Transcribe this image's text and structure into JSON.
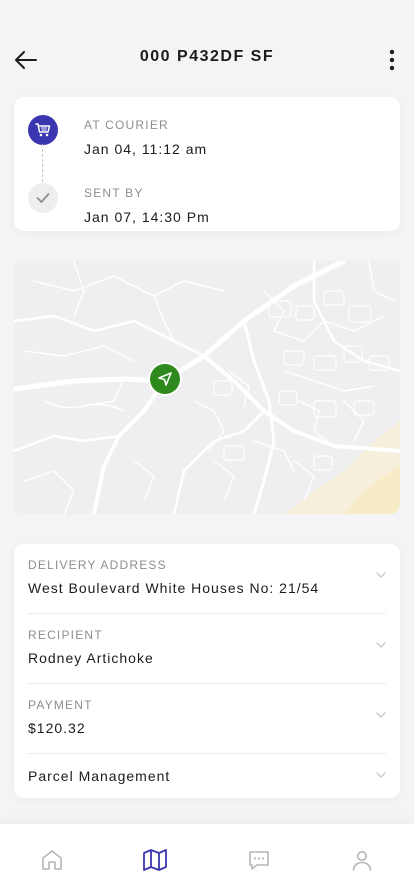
{
  "header": {
    "title": "000 P432DF SF"
  },
  "timeline": [
    {
      "label": "AT COURIER",
      "value": "Jan 04, 11:12 am",
      "icon": "cart-icon",
      "status": "active"
    },
    {
      "label": "SENT BY",
      "value": "Jan 07, 14:30 Pm",
      "icon": "check-icon",
      "status": "done"
    }
  ],
  "map": {
    "pin_icon": "navigation-arrow-icon"
  },
  "details": [
    {
      "label": "DELIVERY ADDRESS",
      "value": "West Boulevard White Houses No: 21/54"
    },
    {
      "label": "RECIPIENT",
      "value": "Rodney Artichoke"
    },
    {
      "label": "PAYMENT",
      "value": "$120.32"
    },
    {
      "label": "",
      "value": "Parcel Management"
    }
  ],
  "bottom_nav": {
    "items": [
      "home-icon",
      "map-icon",
      "chat-icon",
      "profile-icon"
    ],
    "active_index": 1
  },
  "colors": {
    "accent": "#3a36b0",
    "pin": "#2f8a1e",
    "muted": "#8e8e93",
    "inactive_icon": "#b5b5ba"
  }
}
